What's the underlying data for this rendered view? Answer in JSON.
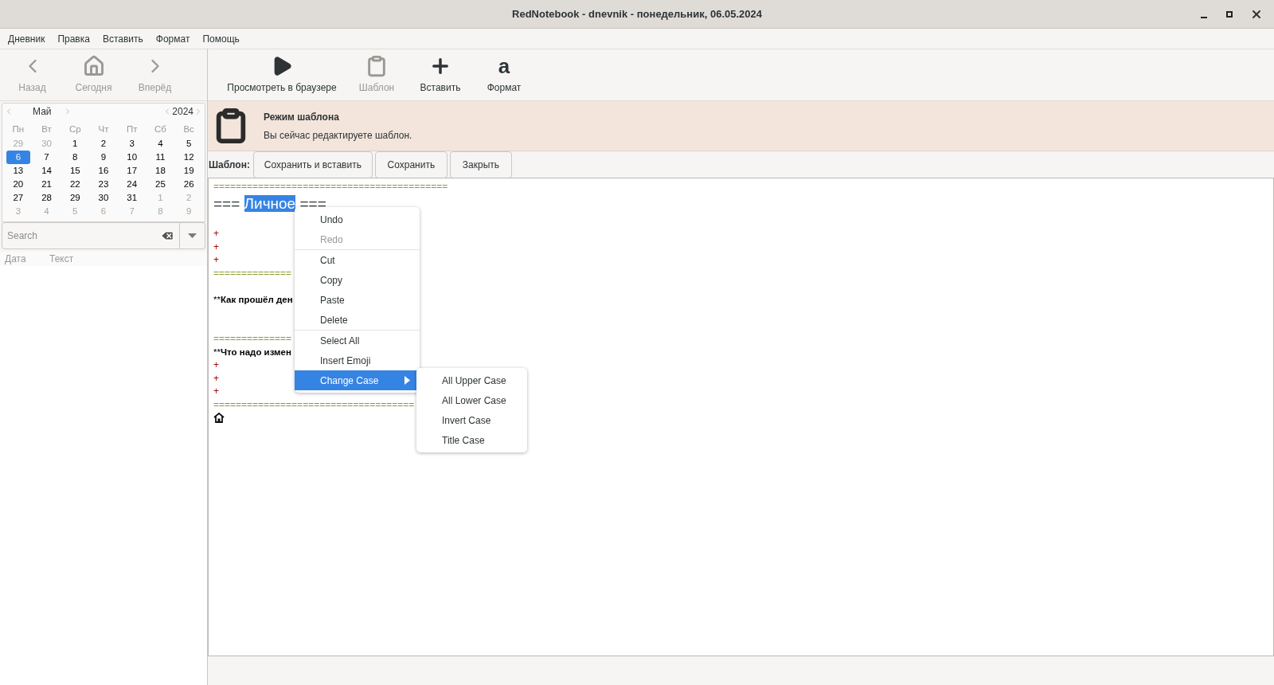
{
  "window": {
    "title": "RedNotebook - dnevnik - понедельник, 06.05.2024"
  },
  "menu_bar": [
    "Дневник",
    "Правка",
    "Вставить",
    "Формат",
    "Помощь"
  ],
  "nav_toolbar": [
    {
      "kind": "back",
      "label": "Назад",
      "disabled": true
    },
    {
      "kind": "home",
      "label": "Сегодня",
      "disabled": true
    },
    {
      "kind": "forward",
      "label": "Вперёд",
      "disabled": true
    }
  ],
  "main_toolbar": [
    {
      "kind": "play",
      "label": "Просмотреть в браузере",
      "disabled": false
    },
    {
      "kind": "clipboard",
      "label": "Шаблон",
      "disabled": true
    },
    {
      "kind": "plus",
      "label": "Вставить",
      "disabled": false
    },
    {
      "kind": "glyph",
      "glyph": "a",
      "label": "Формат",
      "disabled": false
    }
  ],
  "calendar": {
    "month": "Май",
    "year": "2024",
    "weekdays": [
      "Пн",
      "Вт",
      "Ср",
      "Чт",
      "Пт",
      "Сб",
      "Вс"
    ],
    "weeks": [
      [
        {
          "day": "29",
          "muted": true,
          "selected": false
        },
        {
          "day": "30",
          "muted": true,
          "selected": false
        },
        {
          "day": "1",
          "muted": false,
          "selected": false
        },
        {
          "day": "2",
          "muted": false,
          "selected": false
        },
        {
          "day": "3",
          "muted": false,
          "selected": false
        },
        {
          "day": "4",
          "muted": false,
          "selected": false
        },
        {
          "day": "5",
          "muted": false,
          "selected": false
        }
      ],
      [
        {
          "day": "6",
          "muted": false,
          "selected": true
        },
        {
          "day": "7",
          "muted": false,
          "selected": false
        },
        {
          "day": "8",
          "muted": false,
          "selected": false
        },
        {
          "day": "9",
          "muted": false,
          "selected": false
        },
        {
          "day": "10",
          "muted": false,
          "selected": false
        },
        {
          "day": "11",
          "muted": false,
          "selected": false
        },
        {
          "day": "12",
          "muted": false,
          "selected": false
        }
      ],
      [
        {
          "day": "13",
          "muted": false,
          "selected": false
        },
        {
          "day": "14",
          "muted": false,
          "selected": false
        },
        {
          "day": "15",
          "muted": false,
          "selected": false
        },
        {
          "day": "16",
          "muted": false,
          "selected": false
        },
        {
          "day": "17",
          "muted": false,
          "selected": false
        },
        {
          "day": "18",
          "muted": false,
          "selected": false
        },
        {
          "day": "19",
          "muted": false,
          "selected": false
        }
      ],
      [
        {
          "day": "20",
          "muted": false,
          "selected": false
        },
        {
          "day": "21",
          "muted": false,
          "selected": false
        },
        {
          "day": "22",
          "muted": false,
          "selected": false
        },
        {
          "day": "23",
          "muted": false,
          "selected": false
        },
        {
          "day": "24",
          "muted": false,
          "selected": false
        },
        {
          "day": "25",
          "muted": false,
          "selected": false
        },
        {
          "day": "26",
          "muted": false,
          "selected": false
        }
      ],
      [
        {
          "day": "27",
          "muted": false,
          "selected": false
        },
        {
          "day": "28",
          "muted": false,
          "selected": false
        },
        {
          "day": "29",
          "muted": false,
          "selected": false
        },
        {
          "day": "30",
          "muted": false,
          "selected": false
        },
        {
          "day": "31",
          "muted": false,
          "selected": false
        },
        {
          "day": "1",
          "muted": true,
          "selected": false
        },
        {
          "day": "2",
          "muted": true,
          "selected": false
        }
      ],
      [
        {
          "day": "3",
          "muted": true,
          "selected": false
        },
        {
          "day": "4",
          "muted": true,
          "selected": false
        },
        {
          "day": "5",
          "muted": true,
          "selected": false
        },
        {
          "day": "6",
          "muted": true,
          "selected": false
        },
        {
          "day": "7",
          "muted": true,
          "selected": false
        },
        {
          "day": "8",
          "muted": true,
          "selected": false
        },
        {
          "day": "9",
          "muted": true,
          "selected": false
        }
      ]
    ]
  },
  "search": {
    "placeholder": "Search"
  },
  "results_columns": [
    "Дата",
    "Текст"
  ],
  "banner": {
    "title": "Режим шаблона",
    "message": "Вы сейчас редактируете шаблон."
  },
  "template_bar": {
    "label": "Шаблон:",
    "buttons": [
      "Сохранить и вставить",
      "Сохранить",
      "Закрыть"
    ]
  },
  "editor_lines": [
    {
      "kind": "rule",
      "text": "=========================================="
    },
    {
      "kind": "heading",
      "marker": "===",
      "text": "Личное",
      "selected": true,
      "marker_end": "==="
    },
    {
      "kind": "blank"
    },
    {
      "kind": "plus",
      "text": "+"
    },
    {
      "kind": "plus",
      "text": "+"
    },
    {
      "kind": "plus",
      "text": "+"
    },
    {
      "kind": "rule",
      "text": "=============="
    },
    {
      "kind": "blank"
    },
    {
      "kind": "bold",
      "marker": "**",
      "text": "Как прошёл ден"
    },
    {
      "kind": "blank"
    },
    {
      "kind": "blank"
    },
    {
      "kind": "rule",
      "text": "=============="
    },
    {
      "kind": "bold",
      "marker": "**",
      "text": "Что надо измен"
    },
    {
      "kind": "plus",
      "text": "+"
    },
    {
      "kind": "plus",
      "text": "+"
    },
    {
      "kind": "plus",
      "text": "+"
    },
    {
      "kind": "rule",
      "text": "===================================="
    },
    {
      "kind": "image"
    }
  ],
  "context_menu": {
    "groups": [
      [
        {
          "label": "Undo",
          "disabled": false,
          "selected": false,
          "has_submenu": false
        },
        {
          "label": "Redo",
          "disabled": true,
          "selected": false,
          "has_submenu": false
        }
      ],
      [
        {
          "label": "Cut",
          "disabled": false,
          "selected": false,
          "has_submenu": false
        },
        {
          "label": "Copy",
          "disabled": false,
          "selected": false,
          "has_submenu": false
        },
        {
          "label": "Paste",
          "disabled": false,
          "selected": false,
          "has_submenu": false
        },
        {
          "label": "Delete",
          "disabled": false,
          "selected": false,
          "has_submenu": false
        }
      ],
      [
        {
          "label": "Select All",
          "disabled": false,
          "selected": false,
          "has_submenu": false
        },
        {
          "label": "Insert Emoji",
          "disabled": false,
          "selected": false,
          "has_submenu": false
        },
        {
          "label": "Change Case",
          "disabled": false,
          "selected": true,
          "has_submenu": true
        }
      ]
    ],
    "submenu": [
      "All Upper Case",
      "All Lower Case",
      "Invert Case",
      "Title Case"
    ]
  }
}
